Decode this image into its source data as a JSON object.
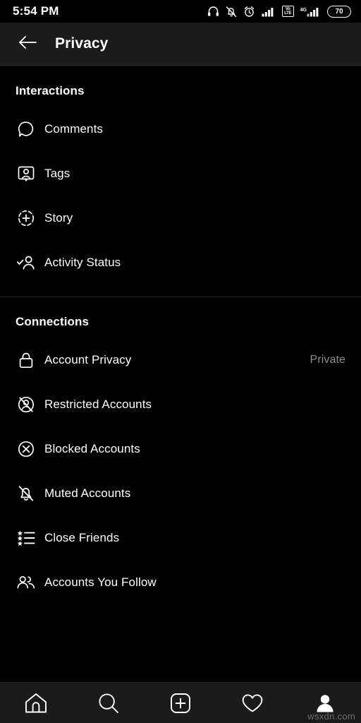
{
  "statusbar": {
    "time": "5:54 PM",
    "battery_level": "70",
    "volte_top": "Vo",
    "volte_bottom": "LTE",
    "network_label": "4G",
    "icons": [
      "headphones-icon",
      "bell-off-icon",
      "alarm-clock-icon",
      "signal-bars-icon",
      "volte-badge-icon",
      "signal-bars-4g-icon",
      "battery-icon"
    ]
  },
  "header": {
    "title": "Privacy",
    "back_icon": "back-arrow-icon"
  },
  "sections": [
    {
      "title": "Interactions",
      "items": [
        {
          "label": "Comments",
          "icon": "comment-bubble-icon",
          "value": ""
        },
        {
          "label": "Tags",
          "icon": "tag-person-icon",
          "value": ""
        },
        {
          "label": "Story",
          "icon": "story-plus-circle-icon",
          "value": ""
        },
        {
          "label": "Activity Status",
          "icon": "activity-status-icon",
          "value": ""
        }
      ]
    },
    {
      "title": "Connections",
      "items": [
        {
          "label": "Account Privacy",
          "icon": "lock-icon",
          "value": "Private"
        },
        {
          "label": "Restricted Accounts",
          "icon": "restricted-person-icon",
          "value": ""
        },
        {
          "label": "Blocked Accounts",
          "icon": "blocked-x-circle-icon",
          "value": ""
        },
        {
          "label": "Muted Accounts",
          "icon": "bell-muted-icon",
          "value": ""
        },
        {
          "label": "Close Friends",
          "icon": "star-list-icon",
          "value": ""
        },
        {
          "label": "Accounts You Follow",
          "icon": "two-people-icon",
          "value": ""
        }
      ]
    }
  ],
  "bottomnav": {
    "items": [
      {
        "name": "home",
        "icon": "home-icon"
      },
      {
        "name": "search",
        "icon": "search-icon"
      },
      {
        "name": "create",
        "icon": "plus-square-icon"
      },
      {
        "name": "activity",
        "icon": "heart-icon"
      },
      {
        "name": "profile",
        "icon": "profile-avatar-icon"
      }
    ]
  },
  "watermark": "wsxdn.com",
  "colors": {
    "background": "#000000",
    "surface": "#1b1b1b",
    "divider": "#262626",
    "text_primary": "#ffffff",
    "text_secondary": "#8d8d8d"
  }
}
